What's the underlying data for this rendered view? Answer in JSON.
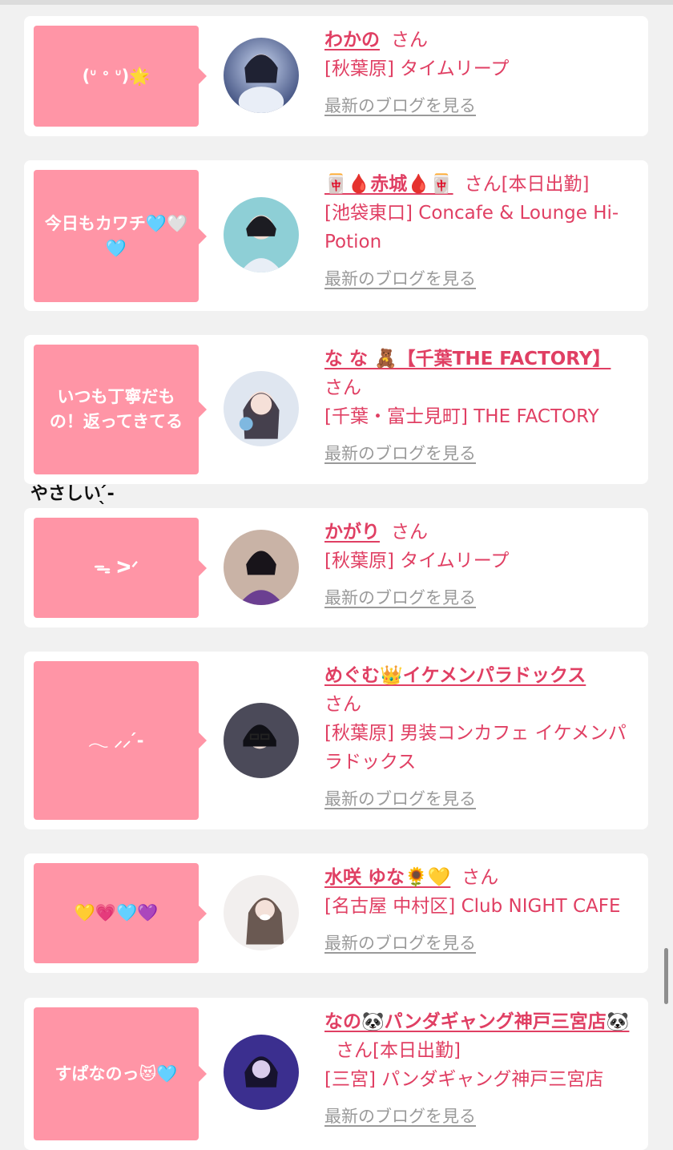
{
  "common": {
    "san": "さん",
    "blog_link": "最新のブログを見る"
  },
  "floating_note": "やさしい ̖́-‬",
  "cards": [
    {
      "bubble": "(ᐡ ᐤ ᐡ)🌟",
      "name": "わかの",
      "status": "",
      "shop": "[秋葉原] タイムリープ"
    },
    {
      "bubble": "今日もカワチ🩵🤍🩵",
      "name": "🀄🩸赤城🩸🀄",
      "status": "[本日出勤]",
      "shop": "[池袋東口] Concafe & Lounge Hi-Potion"
    },
    {
      "bubble": "いつも丁寧だもの！返ってきてる",
      "name": "な な 🧸【千葉THE FACTORY】",
      "status": "",
      "shop": "[千葉・富士見町] THE FACTORY"
    },
    {
      "bubble": "ᯓ ᐳᐟ",
      "name": "かがり",
      "status": "",
      "shop": "[秋葉原] タイムリープ"
    },
    {
      "bubble": "𓂃 ⸝⸝ ́-",
      "name": "めぐむ👑イケメンパラドックス",
      "status": "",
      "shop": "[秋葉原] 男装コンカフェ イケメンパラドックス"
    },
    {
      "bubble": "💛💗🩵💜",
      "name": "水咲 ゆな🌻💛",
      "status": "",
      "shop": "[名古屋 中村区] Club NIGHT CAFE"
    },
    {
      "bubble": "すぱなのっ😻🩵",
      "name": "なの🐼パンダギャング神戸三宮店🐼",
      "status": "[本日出勤]",
      "shop": "[三宮] パンダギャング神戸三宮店"
    }
  ],
  "colors": {
    "accent": "#e03f63",
    "bubble": "#ff95a6",
    "link_gray": "#9a9a9a"
  }
}
